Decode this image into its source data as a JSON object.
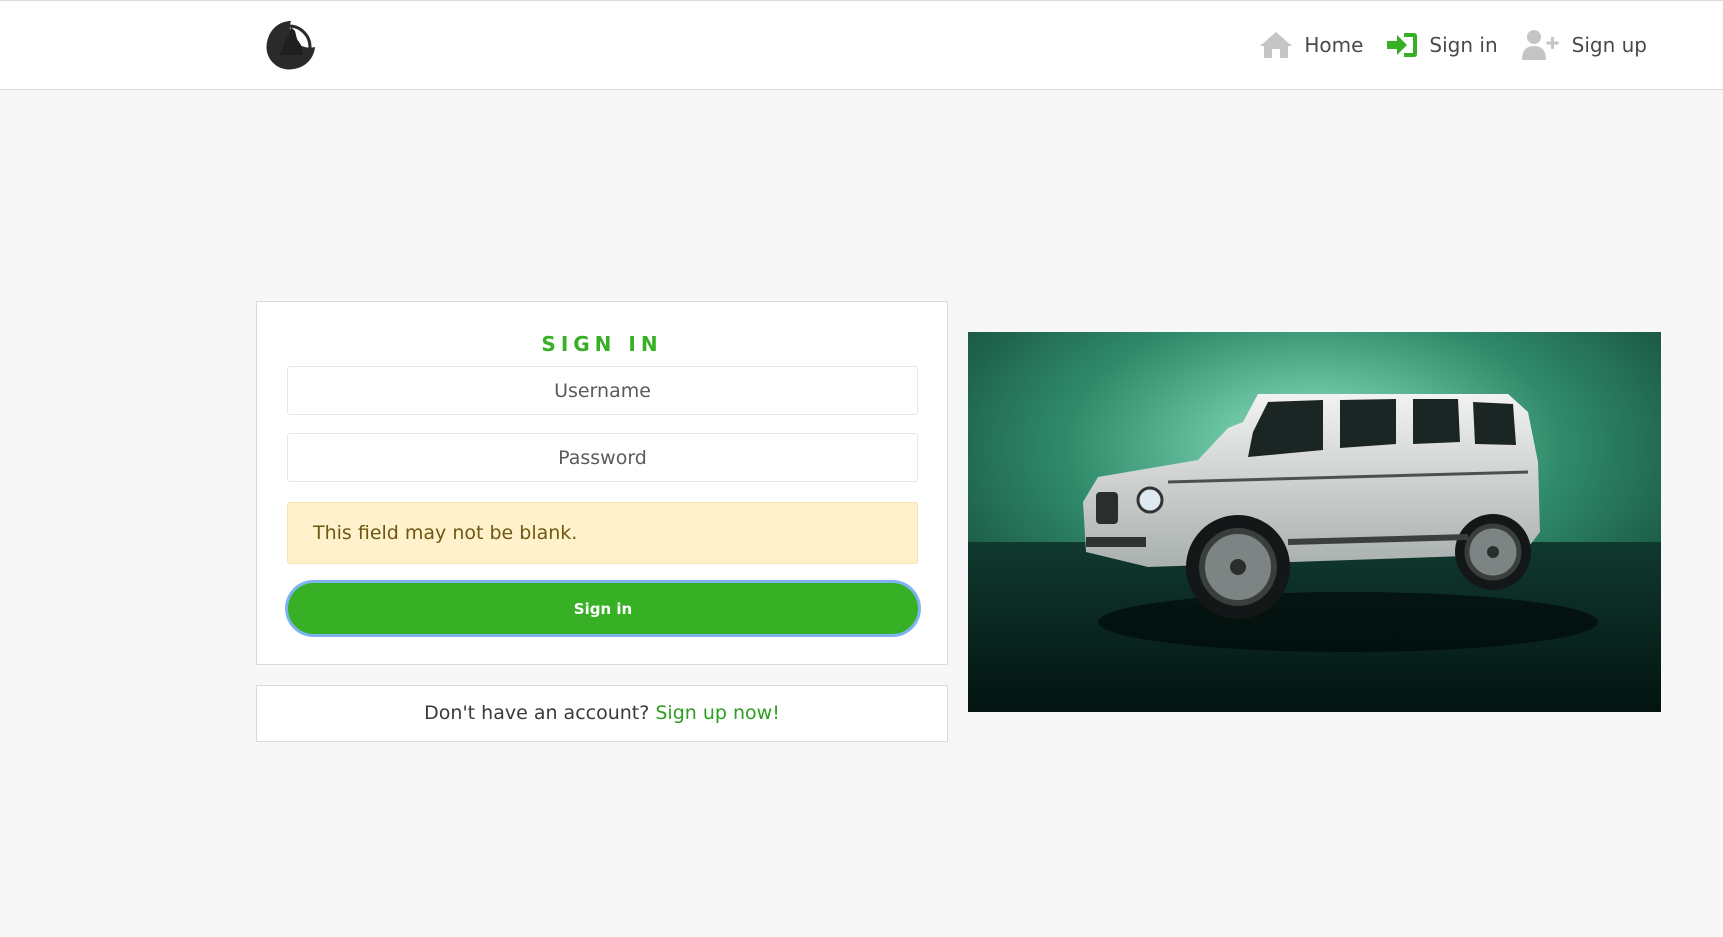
{
  "nav": {
    "logo_alt": "wolf logo",
    "links": [
      {
        "label": "Home",
        "icon": "home-icon"
      },
      {
        "label": "Sign in",
        "icon": "sign-in-icon"
      },
      {
        "label": "Sign up",
        "icon": "user-plus-icon"
      }
    ]
  },
  "signin": {
    "title": "SIGN IN",
    "username_placeholder": "Username",
    "password_placeholder": "Password",
    "error": "This field may not be blank.",
    "button_label": "Sign in"
  },
  "signup_prompt": {
    "text": "Don't have an account?",
    "link": "Sign up now!"
  },
  "colors": {
    "accent": "#37b026",
    "alert_bg": "#fff1cc",
    "alert_text": "#6e5710",
    "focus_ring": "#7db3f0"
  },
  "hero": {
    "subject": "white SUV in teal studio"
  }
}
